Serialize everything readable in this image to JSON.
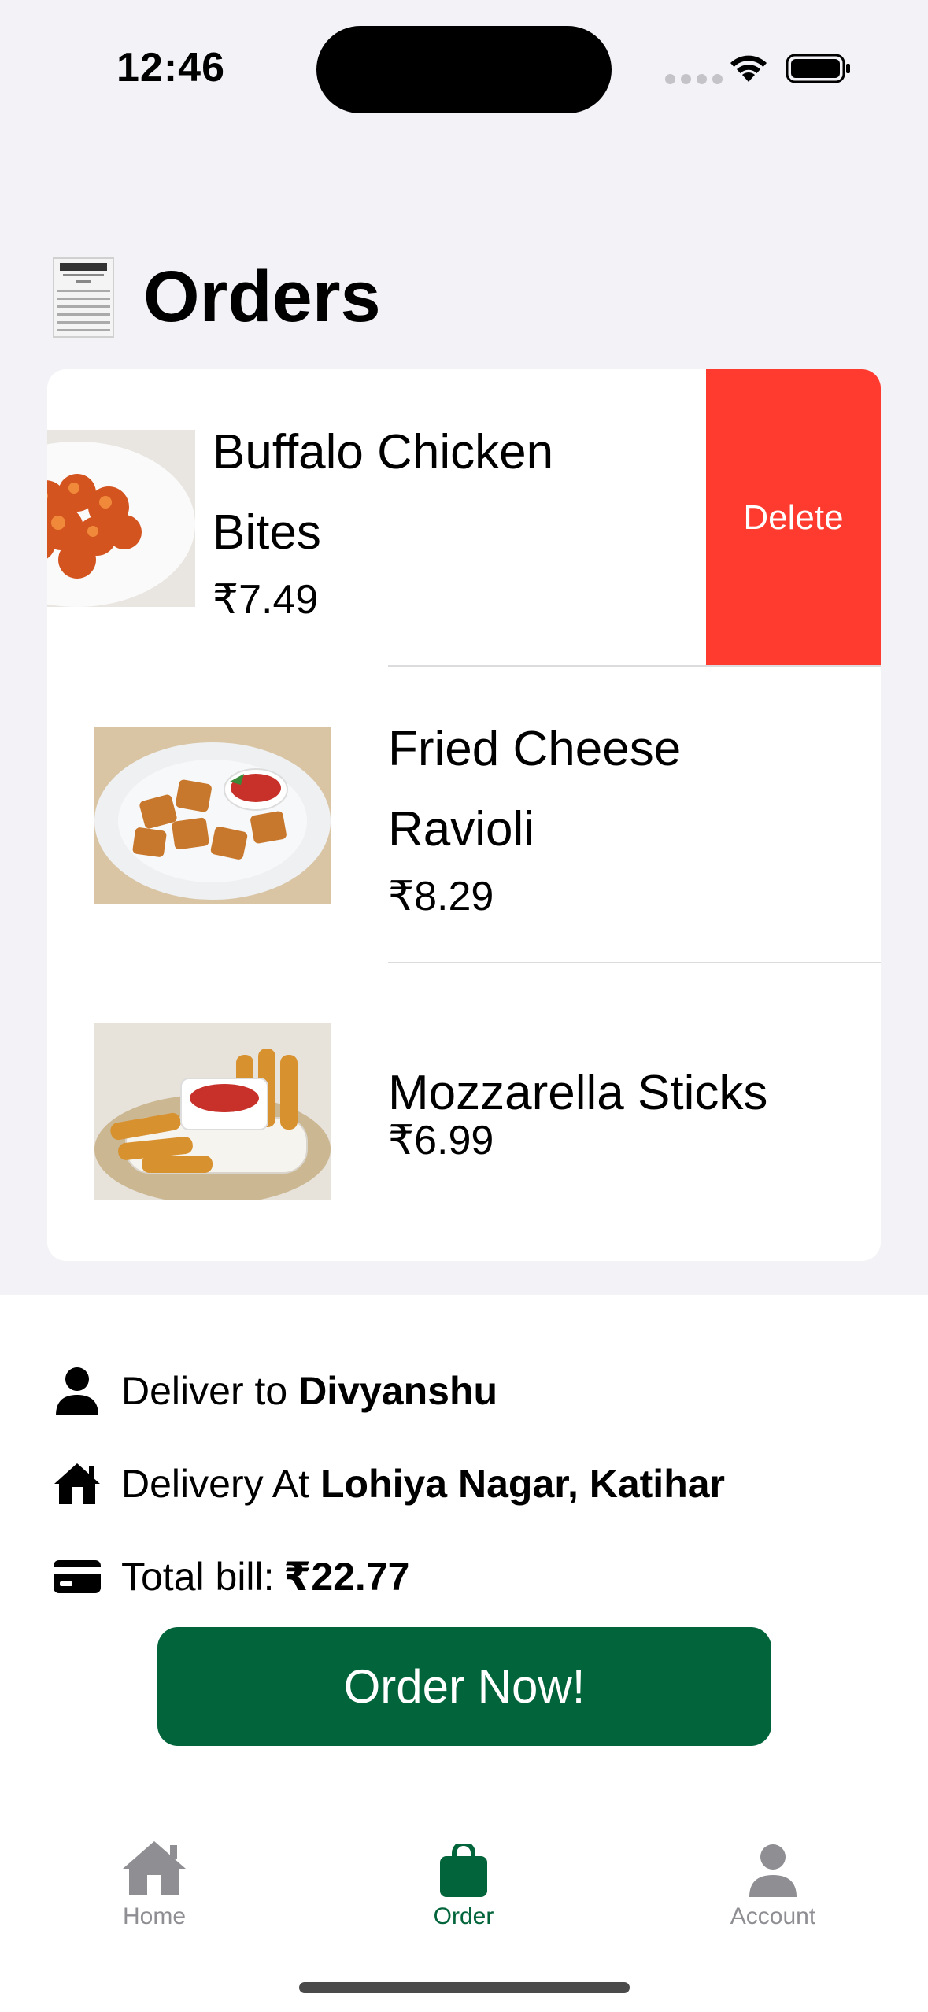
{
  "status_bar": {
    "time": "12:46"
  },
  "page": {
    "title": "Orders"
  },
  "orders": [
    {
      "name": "Buffalo Chicken Bites",
      "price": "₹7.49",
      "swipe_action": "Delete"
    },
    {
      "name": "Fried Cheese Ravioli",
      "price": "₹8.29"
    },
    {
      "name": "Mozzarella Sticks",
      "price": "₹6.99"
    }
  ],
  "delivery": {
    "deliver_to_label": "Deliver to",
    "deliver_to_name": "Divyanshu",
    "delivery_at_label": "Delivery At",
    "delivery_at_address": "Lohiya Nagar, Katihar",
    "total_label": "Total bill:",
    "total_value": "₹22.77"
  },
  "order_button": {
    "label": "Order Now!"
  },
  "tab_bar": {
    "items": [
      {
        "label": "Home",
        "icon": "house-icon",
        "active": false
      },
      {
        "label": "Order",
        "icon": "bag-icon",
        "active": true
      },
      {
        "label": "Account",
        "icon": "person-icon",
        "active": false
      }
    ]
  },
  "colors": {
    "accent": "#02643a",
    "delete": "#ff3b30",
    "background": "#f2f2f7",
    "inactive_tab": "#8e8e93"
  }
}
